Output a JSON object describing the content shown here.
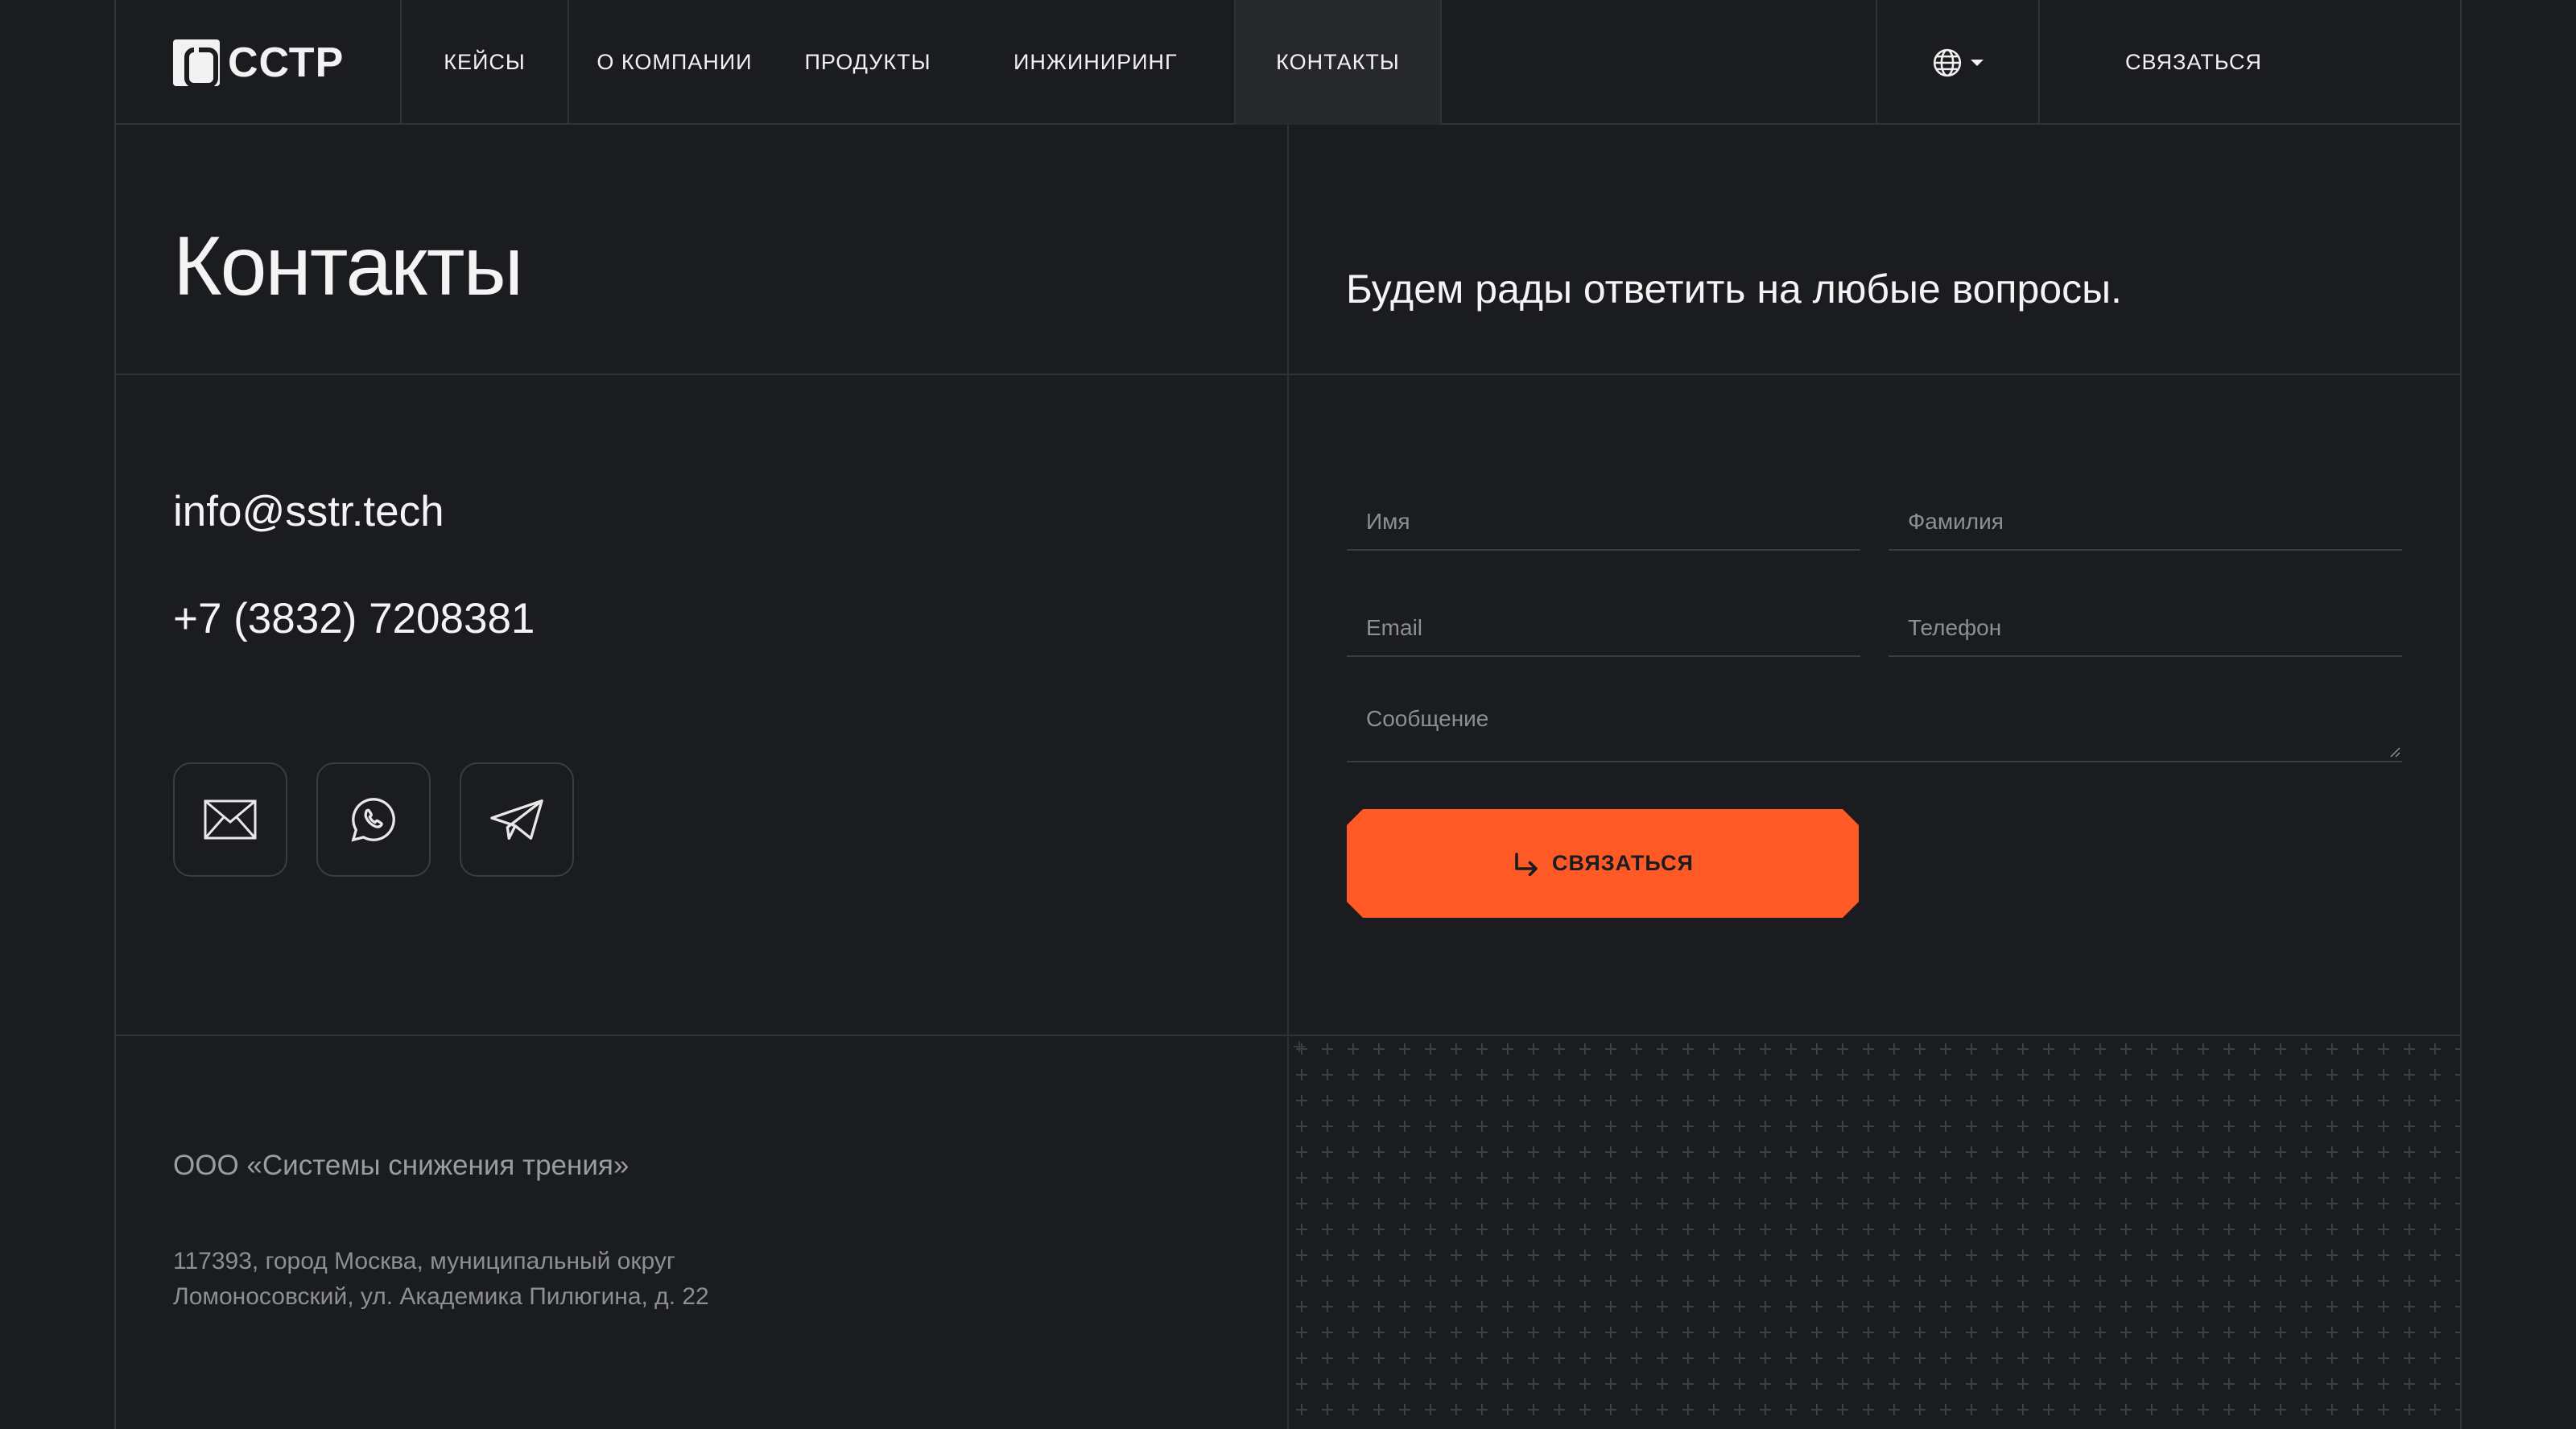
{
  "brand": {
    "name": "ССТР"
  },
  "nav": {
    "items": [
      {
        "label": "КЕЙСЫ"
      },
      {
        "label": "О КОМПАНИИ"
      },
      {
        "label": "ПРОДУКТЫ"
      },
      {
        "label": "ИНЖИНИРИНГ"
      },
      {
        "label": "КОНТАКТЫ",
        "active": true
      }
    ],
    "language_icon": "globe-icon",
    "contact_button": "СВЯЗАТЬСЯ"
  },
  "hero": {
    "title": "Контакты",
    "lead": "Будем рады ответить на любые вопросы."
  },
  "contacts": {
    "email": "info@sstr.tech",
    "phone": "+7 (3832) 7208381",
    "socials": [
      "mail-icon",
      "whatsapp-icon",
      "telegram-icon"
    ]
  },
  "form": {
    "first_name_placeholder": "Имя",
    "last_name_placeholder": "Фамилия",
    "email_placeholder": "Email",
    "phone_placeholder": "Телефон",
    "message_placeholder": "Сообщение",
    "submit_label": "СВЯЗАТЬСЯ",
    "submit_color": "#ff5a26"
  },
  "footer": {
    "company": "ООО «Системы снижения трения»",
    "address_line1": "117393, город Москва, муниципальный округ",
    "address_line2": "Ломоносовский, ул. Академика Пилюгина, д. 22"
  },
  "colors": {
    "background": "#1b1c1f",
    "border": "#303236",
    "accent": "#ff5a26"
  }
}
